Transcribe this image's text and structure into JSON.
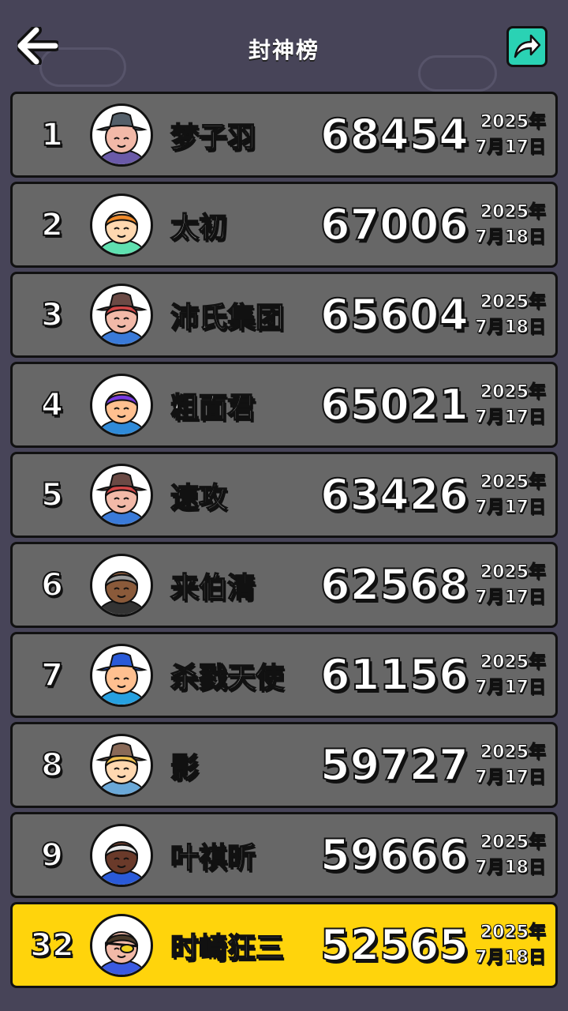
{
  "header": {
    "title": "封神榜",
    "back_icon": "back-arrow-icon",
    "share_icon": "share-icon",
    "share_color": "#2ad2b4"
  },
  "colors": {
    "background": "#474458",
    "row": "#676767",
    "self_row": "#ffd40c"
  },
  "leaderboard": [
    {
      "rank": "1",
      "name": "梦子羽",
      "score": "68454",
      "year": "2025年",
      "day": "7月17日",
      "avatar": "avatar-hat-gray"
    },
    {
      "rank": "2",
      "name": "太初",
      "score": "67006",
      "year": "2025年",
      "day": "7月18日",
      "avatar": "avatar-orange-hair"
    },
    {
      "rank": "3",
      "name": "沛氏集团",
      "score": "65604",
      "year": "2025年",
      "day": "7月18日",
      "avatar": "avatar-hat-brown"
    },
    {
      "rank": "4",
      "name": "粗面君",
      "score": "65021",
      "year": "2025年",
      "day": "7月17日",
      "avatar": "avatar-purple-hair"
    },
    {
      "rank": "5",
      "name": "速攻",
      "score": "63426",
      "year": "2025年",
      "day": "7月17日",
      "avatar": "avatar-hat-brown"
    },
    {
      "rank": "6",
      "name": "来伯清",
      "score": "62568",
      "year": "2025年",
      "day": "7月17日",
      "avatar": "avatar-old-man"
    },
    {
      "rank": "7",
      "name": "杀戮天使",
      "score": "61156",
      "year": "2025年",
      "day": "7月17日",
      "avatar": "avatar-blue-helmet"
    },
    {
      "rank": "8",
      "name": "影",
      "score": "59727",
      "year": "2025年",
      "day": "7月17日",
      "avatar": "avatar-hat-brown-blond"
    },
    {
      "rank": "9",
      "name": "叶祺昕",
      "score": "59666",
      "year": "2025年",
      "day": "7月18日",
      "avatar": "avatar-white-hair"
    },
    {
      "rank": "32",
      "name": "时崎狂三",
      "score": "52565",
      "year": "2025年",
      "day": "7月18日",
      "avatar": "avatar-eyepatch",
      "is_self": true
    }
  ]
}
